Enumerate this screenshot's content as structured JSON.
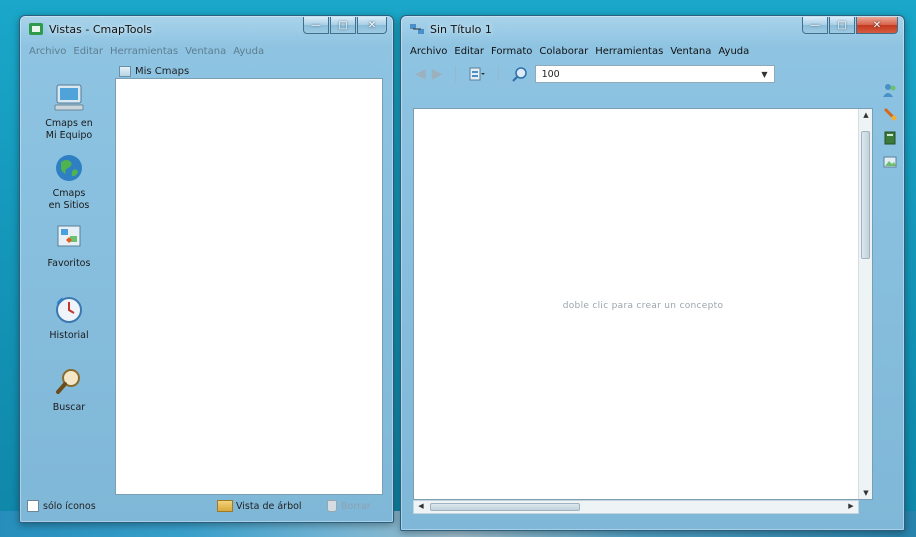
{
  "vistas_window": {
    "title": "Vistas - CmapTools",
    "menu": [
      "Archivo",
      "Editar",
      "Herramientas",
      "Ventana",
      "Ayuda"
    ],
    "nav_items": [
      {
        "label": "Cmaps en\nMi Equipo",
        "icon": "computer-icon"
      },
      {
        "label": "Cmaps\nen Sitios",
        "icon": "globe-icon"
      },
      {
        "label": "Favoritos",
        "icon": "favorites-icon"
      },
      {
        "label": "Historial",
        "icon": "history-clock-icon"
      },
      {
        "label": "Buscar",
        "icon": "magnifier-icon"
      }
    ],
    "folder_header": "Mis Cmaps",
    "bottom": {
      "icons_only_label": "sólo íconos",
      "tree_view_label": "Vista de árbol",
      "delete_label": "Borrar"
    }
  },
  "map_window": {
    "title": "Sin Título 1",
    "menu": [
      "Archivo",
      "Editar",
      "Formato",
      "Colaborar",
      "Herramientas",
      "Ventana",
      "Ayuda"
    ],
    "zoom_value": "100",
    "canvas_hint": "doble clic para crear un concepto"
  },
  "colors": {
    "desktop": "#1598bb",
    "window_frame": "#8ec4e2",
    "close_button": "#c3391f"
  }
}
